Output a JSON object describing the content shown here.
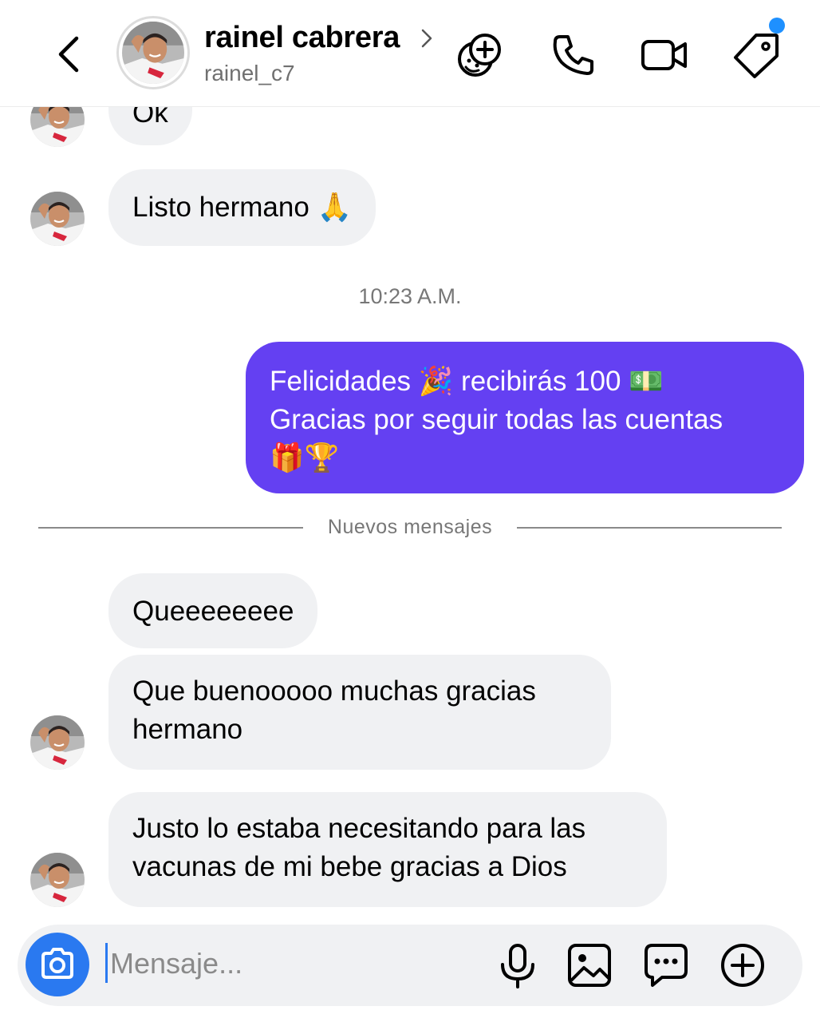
{
  "header": {
    "name": "rainel cabrera",
    "username": "rainel_c7"
  },
  "messages": {
    "partial_top": "Ok",
    "listo": "Listo hermano 🙏",
    "timestamp": "10:23 A.M.",
    "sent_line1": "Felicidades 🎉 recibirás 100 💵",
    "sent_line2": "Gracias por seguir todas las cuentas",
    "sent_line3": "🎁🏆",
    "divider_label": "Nuevos mensajes",
    "m1": "Queeeeeeee",
    "m2_line1": "Que buenooooo muchas gracias",
    "m2_line2": "hermano",
    "m3_line1": "Justo lo estaba necesitando para las",
    "m3_line2": "vacunas de mi bebe gracias a Dios"
  },
  "composer": {
    "placeholder": "Mensaje..."
  },
  "colors": {
    "sent_bubble": "#6440f2",
    "received_bubble": "#f0f1f3",
    "camera_button": "#2a79f0",
    "notification_dot": "#1e90ff"
  },
  "icons": [
    "back-chevron-icon",
    "chevron-right-icon",
    "effects-add-icon",
    "phone-icon",
    "video-camera-icon",
    "tag-icon",
    "camera-icon",
    "microphone-icon",
    "gallery-icon",
    "sticker-chat-icon",
    "plus-circle-icon"
  ]
}
